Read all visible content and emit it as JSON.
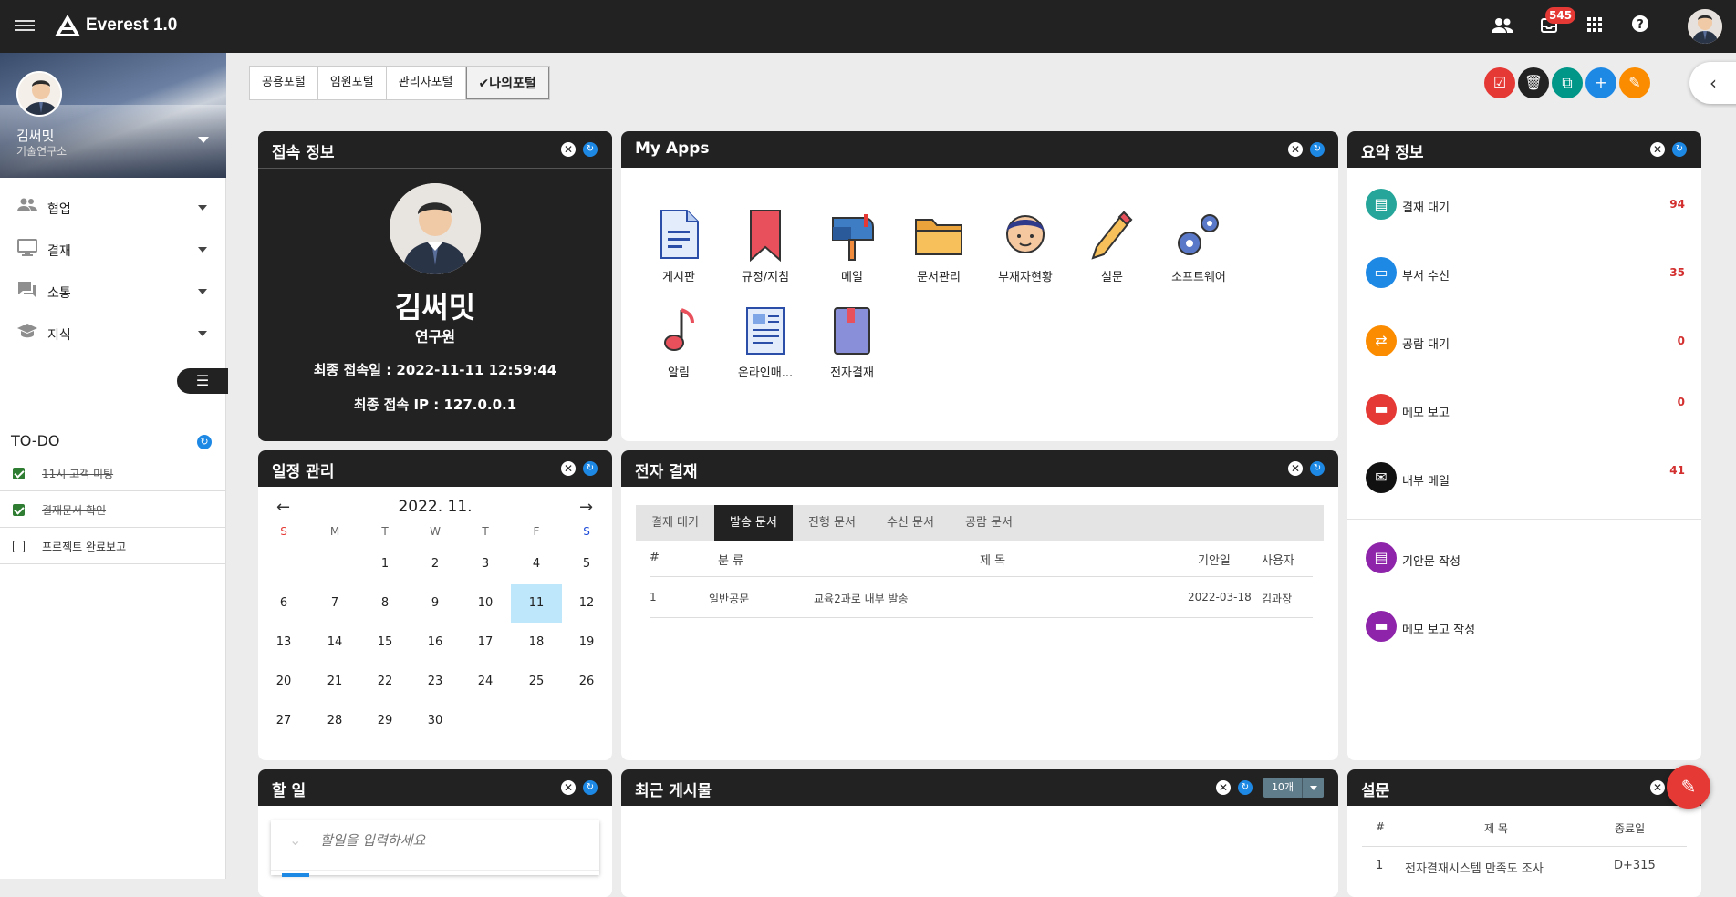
{
  "app": {
    "title": "Everest 1.0",
    "notification_count": "545"
  },
  "topbar_icons": [
    "people-icon",
    "bell-box-icon",
    "apps-grid-icon",
    "help-icon"
  ],
  "user": {
    "name": "김써밋",
    "dept": "기술연구소",
    "rank": "연구원"
  },
  "sidebar": {
    "items": [
      {
        "label": "협업",
        "icon": "people-icon"
      },
      {
        "label": "결재",
        "icon": "monitor-icon"
      },
      {
        "label": "소통",
        "icon": "chat-icon"
      },
      {
        "label": "지식",
        "icon": "graduation-cap-icon"
      }
    ]
  },
  "todo": {
    "title": "TO-DO",
    "items": [
      {
        "text": "11시 고객 미팅",
        "done": true
      },
      {
        "text": "결재문서 확인",
        "done": true
      },
      {
        "text": "프로젝트 완료보고",
        "done": false
      }
    ]
  },
  "portal_tabs": [
    {
      "label": "공용포털"
    },
    {
      "label": "임원포털"
    },
    {
      "label": "관리자포털"
    },
    {
      "label": "나의포털",
      "active": true
    }
  ],
  "action_buttons": [
    {
      "icon": "check-square-icon",
      "color": "#e53935"
    },
    {
      "icon": "trash-icon",
      "color": "#222222"
    },
    {
      "icon": "copy-icon",
      "color": "#009688"
    },
    {
      "icon": "plus-icon",
      "color": "#1e88e5"
    },
    {
      "icon": "edit-icon",
      "color": "#fb8c00"
    }
  ],
  "panels": {
    "access": {
      "title": "접속 정보",
      "last_login_label": "최종 접속일 : 2022-11-11 12:59:44",
      "last_ip_label": "최종 접속 IP : 127.0.0.1"
    },
    "apps": {
      "title": "My Apps",
      "items": [
        "게시판",
        "규정/지침",
        "메일",
        "문서관리",
        "부재자현황",
        "설문",
        "소프트웨어",
        "알림",
        "온라인매...",
        "전자결재"
      ]
    },
    "summary": {
      "title": "요약 정보",
      "items": [
        {
          "label": "결재 대기",
          "value": "94",
          "color": "#26a69a"
        },
        {
          "label": "부서 수신",
          "value": "35",
          "color": "#1e88e5"
        },
        {
          "label": "공람 대기",
          "value": "0",
          "color": "#fb8c00"
        },
        {
          "label": "메모 보고",
          "value": "0",
          "color": "#e53935"
        },
        {
          "label": "내부 메일",
          "value": "41",
          "color": "#111111"
        }
      ],
      "actions": [
        {
          "label": "기안문 작성",
          "color": "#8e24aa"
        },
        {
          "label": "메모 보고 작성",
          "color": "#8e24aa"
        }
      ]
    },
    "schedule": {
      "title": "일정 관리",
      "month_label": "2022. 11.",
      "weekdays": [
        "S",
        "M",
        "T",
        "W",
        "T",
        "F",
        "S"
      ],
      "days": [
        "1",
        "2",
        "3",
        "4",
        "5",
        "6",
        "7",
        "8",
        "9",
        "10",
        "11",
        "12",
        "13",
        "14",
        "15",
        "16",
        "17",
        "18",
        "19",
        "20",
        "21",
        "22",
        "23",
        "24",
        "25",
        "26",
        "27",
        "28",
        "29",
        "30"
      ],
      "today": "11"
    },
    "approval": {
      "title": "전자 결재",
      "tabs": [
        "결재 대기",
        "발송 문서",
        "진행 문서",
        "수신 문서",
        "공람 문서"
      ],
      "active_tab": "발송 문서",
      "columns": [
        "#",
        "분 류",
        "제 목",
        "기안일",
        "사용자"
      ],
      "rows": [
        [
          "1",
          "일반공문",
          "교육2과로 내부 발송",
          "2022-03-18",
          "김과장"
        ]
      ]
    },
    "tasks": {
      "title": "할 일",
      "placeholder": "할일을 입력하세요"
    },
    "recent": {
      "title": "최근 게시물",
      "page_size": "10개"
    },
    "survey": {
      "title": "설문",
      "columns": [
        "#",
        "제 목",
        "종료일"
      ],
      "rows": [
        [
          "1",
          "전자결재시스템 만족도 조사",
          "D+315"
        ]
      ]
    }
  }
}
